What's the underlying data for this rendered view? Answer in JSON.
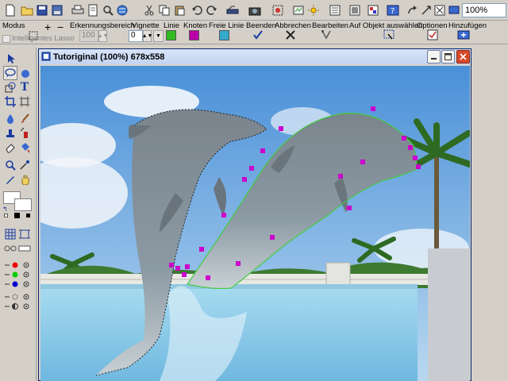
{
  "toolbar": {
    "zoom_value": "100%",
    "icons": [
      "new-icon",
      "open-icon",
      "save-icon",
      "save-as-icon",
      "print-icon",
      "print-preview-icon",
      "scan-icon",
      "web-icon",
      "cut-icon",
      "copy-icon",
      "paste-icon",
      "undo-icon",
      "redo-icon",
      "scanner-icon",
      "camera-icon",
      "effects-icon",
      "adjust-icon",
      "brightness-icon",
      "layers-icon",
      "image-icon",
      "palette-icon",
      "help-icon",
      "forward-icon",
      "zoom-icon",
      "fullscreen-icon"
    ]
  },
  "options": {
    "modus_label": "Modus",
    "erkennung_label": "Erkennungsbereich",
    "vignette_label": "Vignette",
    "linie_label": "Linie",
    "knoten_label": "Knoten",
    "freie_linie_label": "Freie Linie",
    "beenden_label": "Beenden",
    "abbrechen_label": "Abbrechen",
    "bearbeiten_label": "Bearbeiten",
    "auf_objekt_label": "Auf Objekt auswählen",
    "optionen_label": "Optionen",
    "hinzufuegen_label": "Hinzufügen",
    "lasso_label": "Intelligentes Lasso",
    "erkennung_value": "100",
    "vignette_value": "0",
    "linie_color": "#33bb22",
    "knoten_color": "#bb00aa",
    "freie_color": "#33aacc"
  },
  "window": {
    "title": "Tutoriginal (100%) 678x558"
  },
  "colors": {
    "selection_node": "#cc00cc",
    "selection_line": "#44cc44"
  }
}
